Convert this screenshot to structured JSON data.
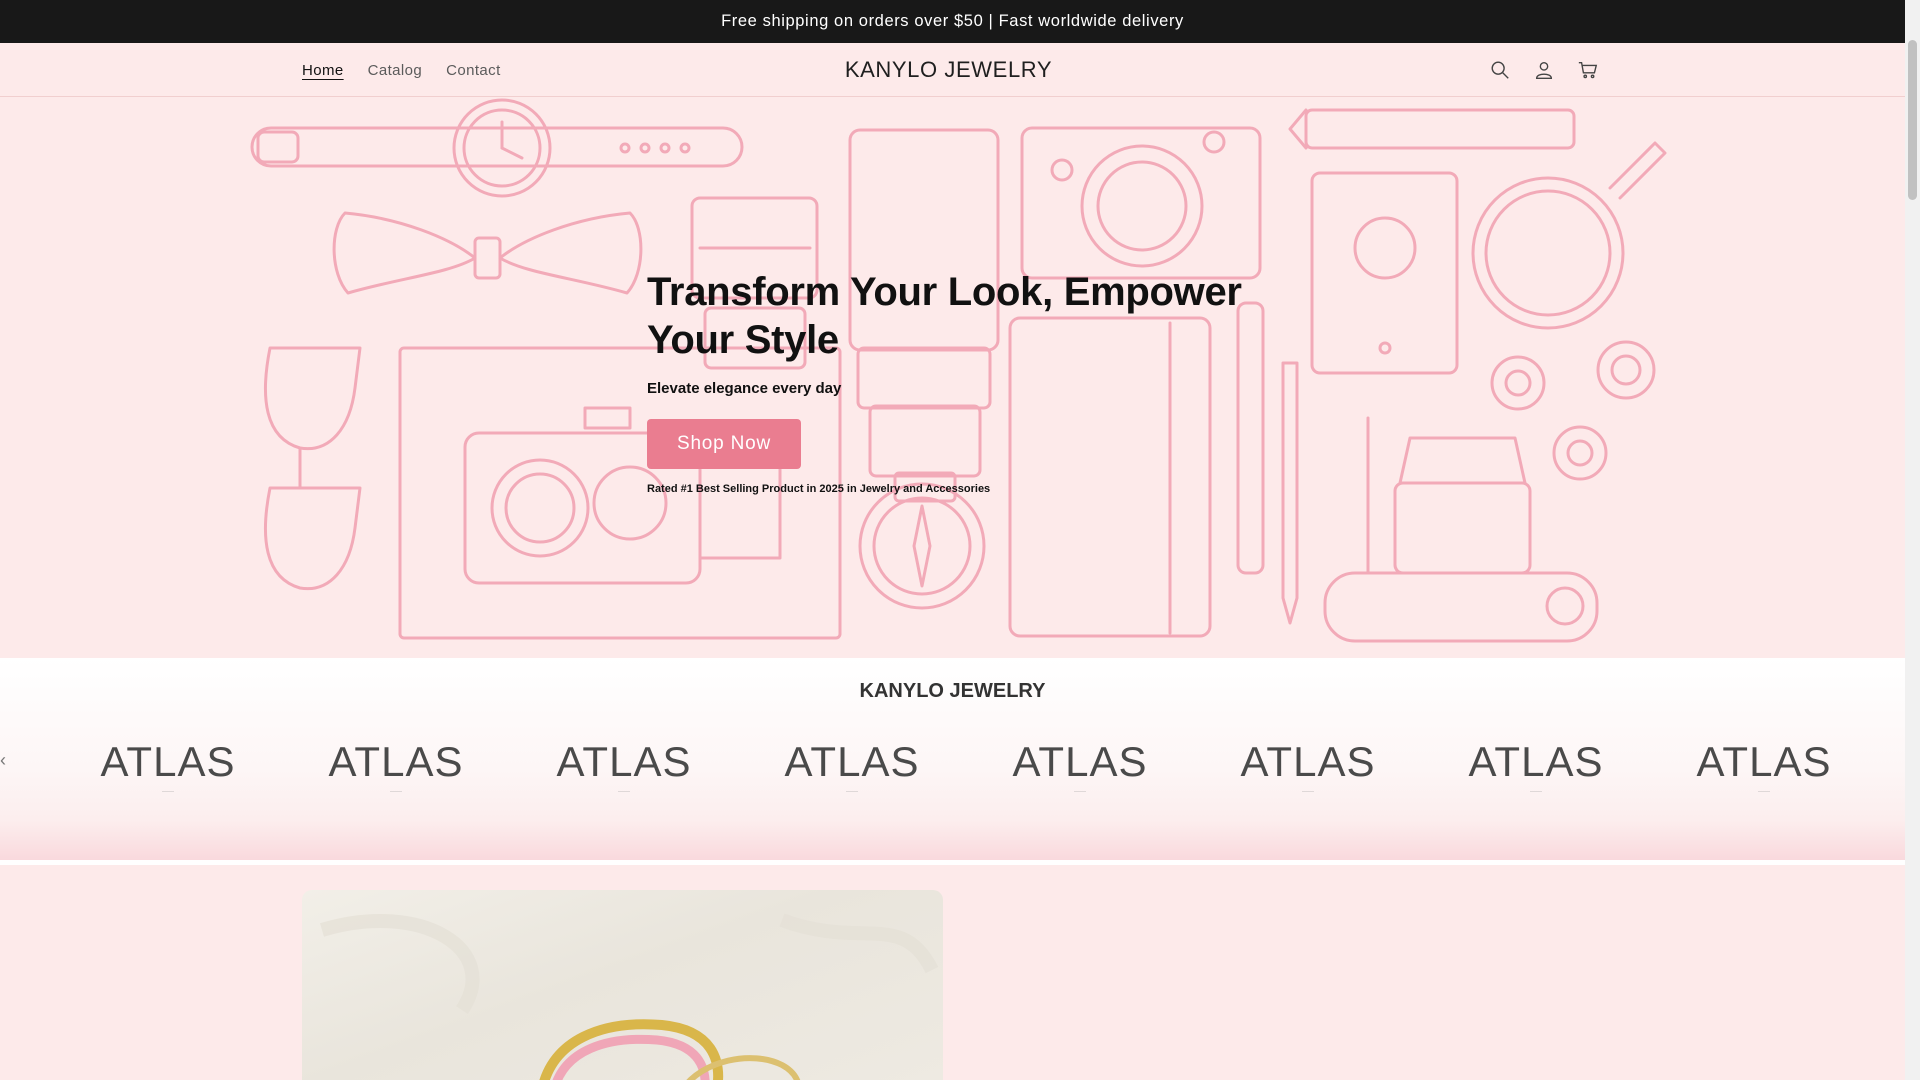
{
  "announcement": "Free shipping on orders over $50 | Fast worldwide delivery",
  "header": {
    "nav": [
      {
        "label": "Home",
        "active": true
      },
      {
        "label": "Catalog",
        "active": false
      },
      {
        "label": "Contact",
        "active": false
      }
    ],
    "logo": "KANYLO JEWELRY",
    "icons": [
      "search-icon",
      "account-icon",
      "cart-icon"
    ]
  },
  "hero": {
    "title": "Transform Your Look, Empower Your Style",
    "subtitle": "Elevate elegance every day",
    "button": "Shop Now",
    "note": "Rated #1 Best Selling Product in 2025 in Jewelry and Accessories"
  },
  "brands": {
    "title": "KANYLO JEWELRY",
    "items": [
      "ATLAS",
      "ATLAS",
      "ATLAS",
      "ATLAS",
      "ATLAS",
      "ATLAS",
      "ATLAS",
      "ATLAS"
    ]
  },
  "colors": {
    "background": "#fdeaea",
    "announcement_bg": "#181818",
    "accent": "#ea7d90",
    "illustration": "#f2aab8"
  }
}
